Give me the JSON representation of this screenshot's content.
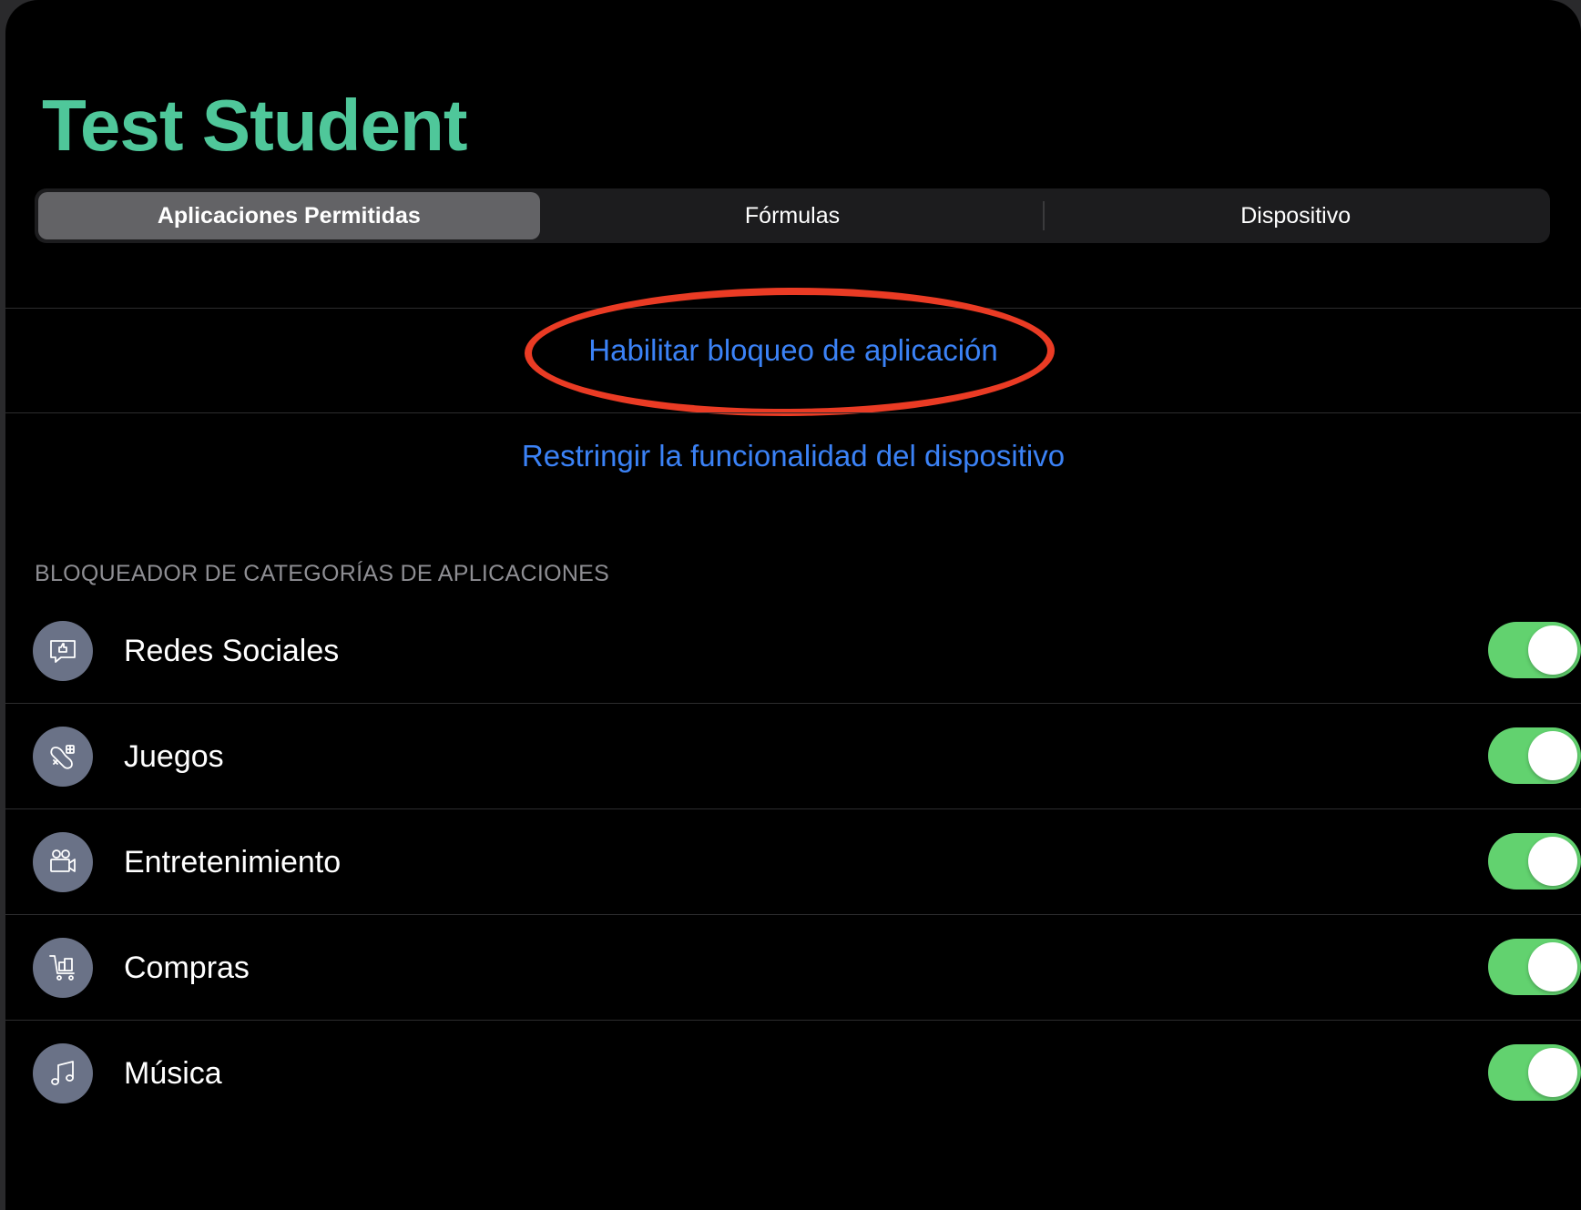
{
  "header": {
    "title": "Test Student"
  },
  "tabs": [
    {
      "label": "Aplicaciones Permitidas",
      "active": true
    },
    {
      "label": "Fórmulas",
      "active": false
    },
    {
      "label": "Dispositivo",
      "active": false
    }
  ],
  "actions": {
    "enable_app_lock": "Habilitar bloqueo de aplicación",
    "restrict_device": "Restringir la funcionalidad del dispositivo"
  },
  "categories": {
    "header": "BLOQUEADOR DE CATEGORÍAS DE APLICACIONES",
    "items": [
      {
        "label": "Redes Sociales",
        "icon": "social-chat-icon",
        "enabled": true
      },
      {
        "label": "Juegos",
        "icon": "game-controller-icon",
        "enabled": true
      },
      {
        "label": "Entretenimiento",
        "icon": "video-camera-icon",
        "enabled": true
      },
      {
        "label": "Compras",
        "icon": "shopping-cart-icon",
        "enabled": true
      },
      {
        "label": "Música",
        "icon": "music-note-icon",
        "enabled": true
      }
    ]
  },
  "colors": {
    "title": "#4fc79a",
    "link": "#3b82f6",
    "toggle_on": "#62d26f",
    "annotation": "#ea3b24",
    "icon_bg": "#6a7287"
  }
}
